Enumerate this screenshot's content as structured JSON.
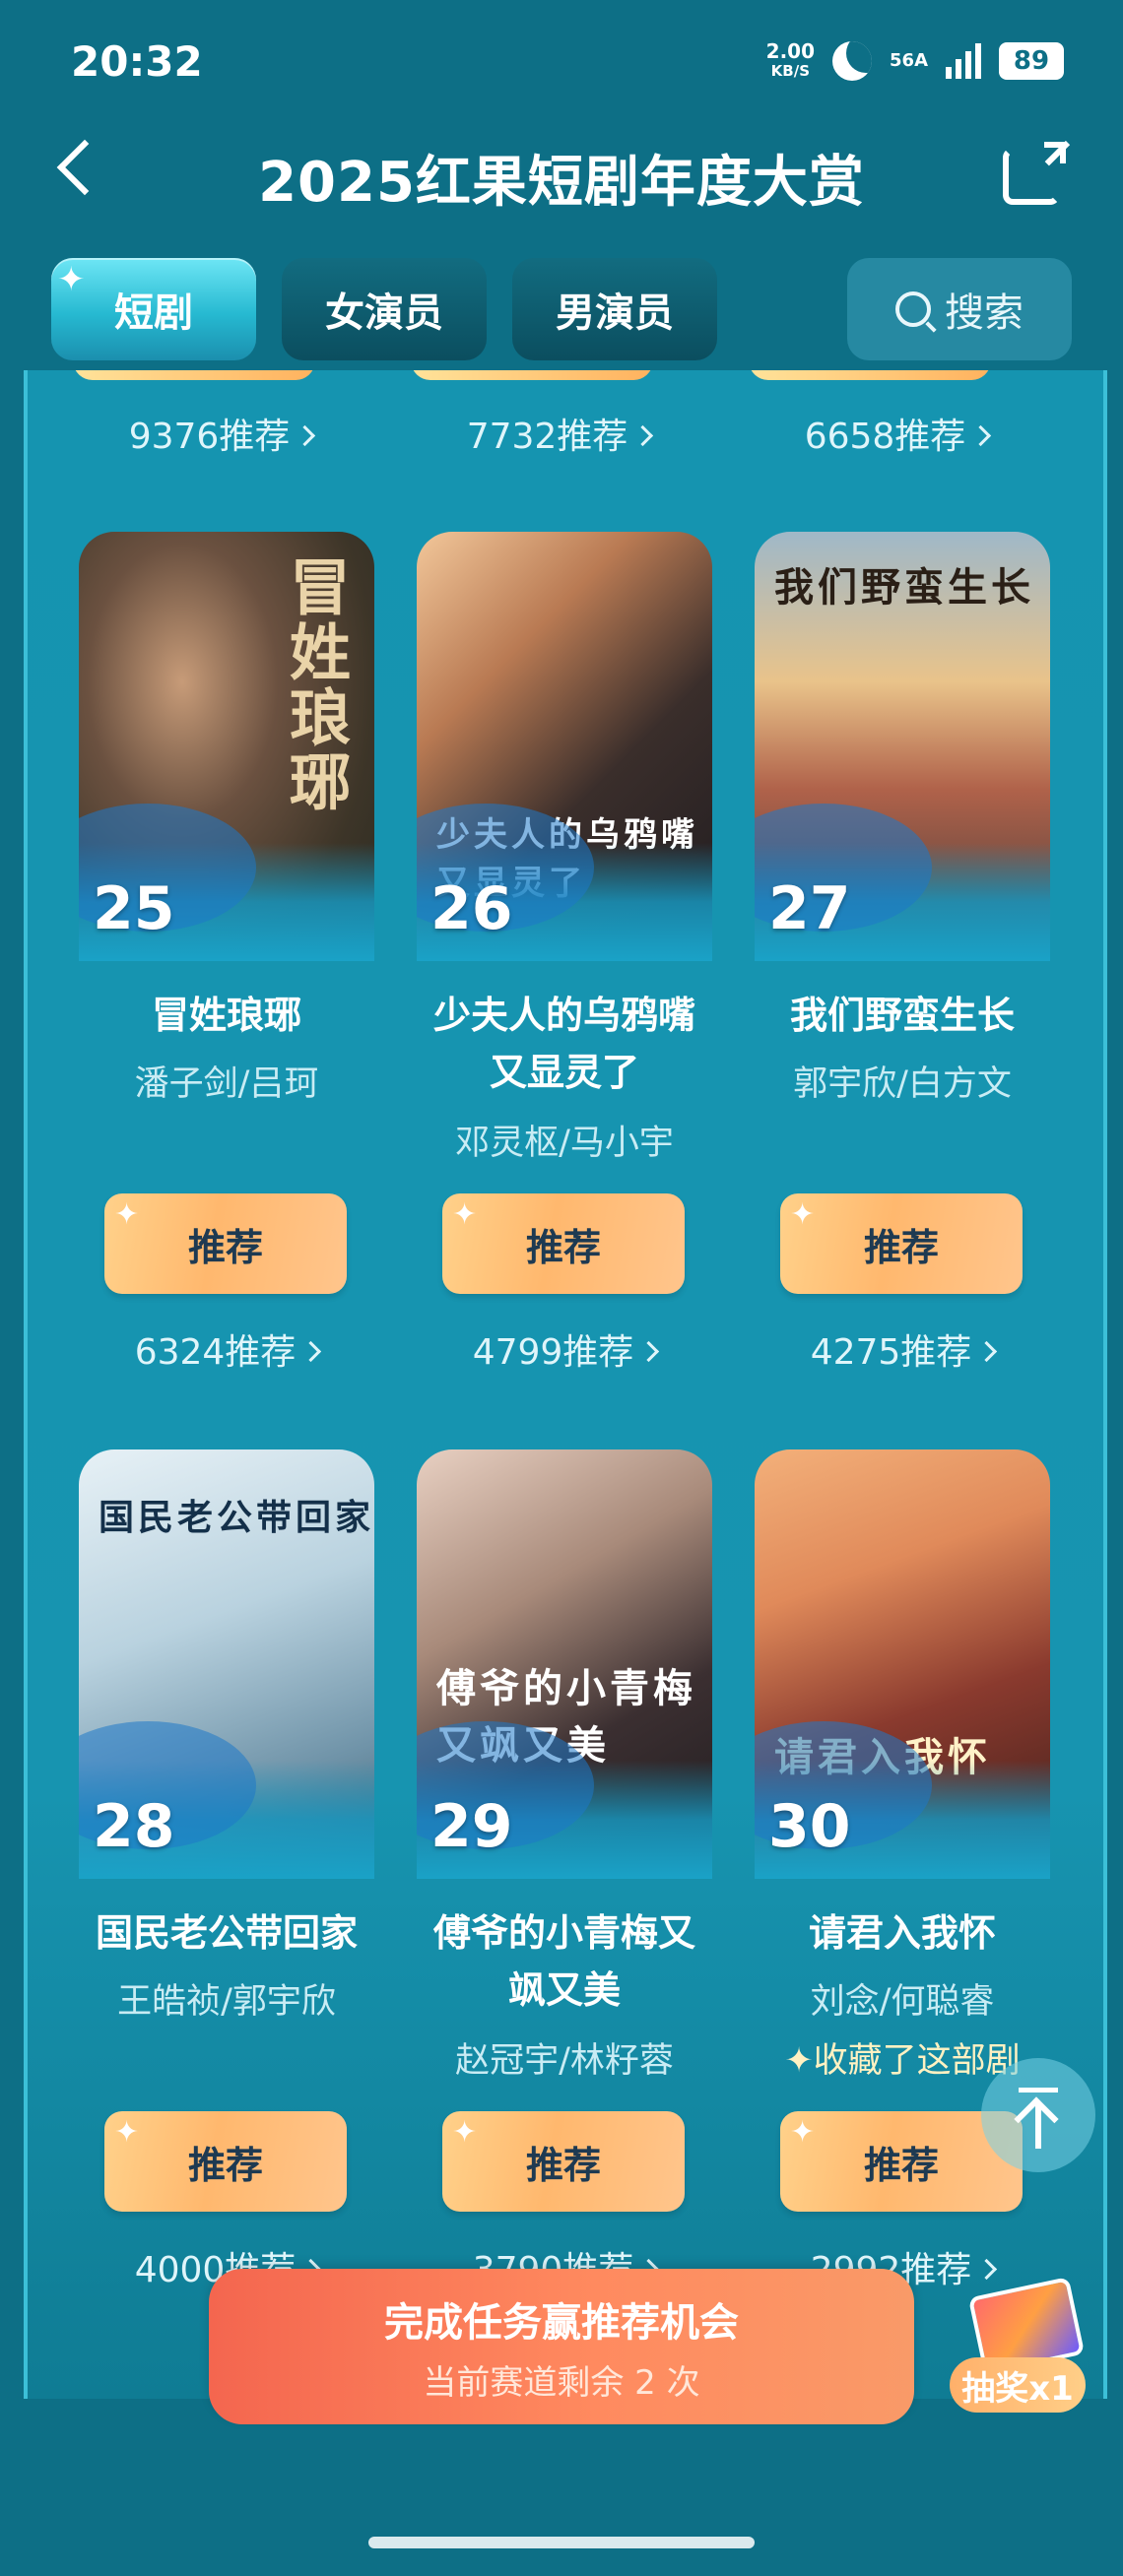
{
  "status_bar": {
    "time": "20:32",
    "speed_value": "2.00",
    "speed_unit": "KB/S",
    "network": "56A",
    "battery": "89"
  },
  "header": {
    "title": "2025红果短剧年度大赏"
  },
  "tabs": [
    {
      "label": "短剧",
      "active": true
    },
    {
      "label": "女演员",
      "active": false
    },
    {
      "label": "男演员",
      "active": false
    }
  ],
  "search": {
    "label": "搜索"
  },
  "top_counts": [
    "9376推荐",
    "7732推荐",
    "6658推荐"
  ],
  "rows": [
    {
      "items": [
        {
          "rank": "25",
          "name": "冒姓琅琊",
          "cast": "潘子剑/吕珂",
          "button": "推荐",
          "count": "6324推荐",
          "poster_text": "冒姓琅琊"
        },
        {
          "rank": "26",
          "name": "少夫人的乌鸦嘴又显灵了",
          "cast": "邓灵枢/马小宇",
          "button": "推荐",
          "count": "4799推荐",
          "poster_text": "少夫人的乌鸦嘴又显灵了"
        },
        {
          "rank": "27",
          "name": "我们野蛮生长",
          "cast": "郭宇欣/白方文",
          "button": "推荐",
          "count": "4275推荐",
          "poster_text": "我们野蛮生长"
        }
      ]
    },
    {
      "items": [
        {
          "rank": "28",
          "name": "国民老公带回家",
          "cast": "王皓祯/郭宇欣",
          "button": "推荐",
          "count": "4000推荐",
          "poster_text": "国民老公带回家"
        },
        {
          "rank": "29",
          "name": "傅爷的小青梅又飒又美",
          "cast": "赵冠宇/林籽蓉",
          "button": "推荐",
          "count": "3790推荐",
          "poster_text": "傅爷的小青梅又飒又美"
        },
        {
          "rank": "30",
          "name": "请君入我怀",
          "cast": "刘念/何聪睿",
          "button": "推荐",
          "count": "2992推荐",
          "poster_text": "请君入我怀",
          "favorited": "收藏了这部剧"
        }
      ]
    }
  ],
  "task_banner": {
    "title": "完成任务赢推荐机会",
    "subtitle": "当前赛道剩余 2 次"
  },
  "lottery": {
    "label": "抽奖x1"
  }
}
